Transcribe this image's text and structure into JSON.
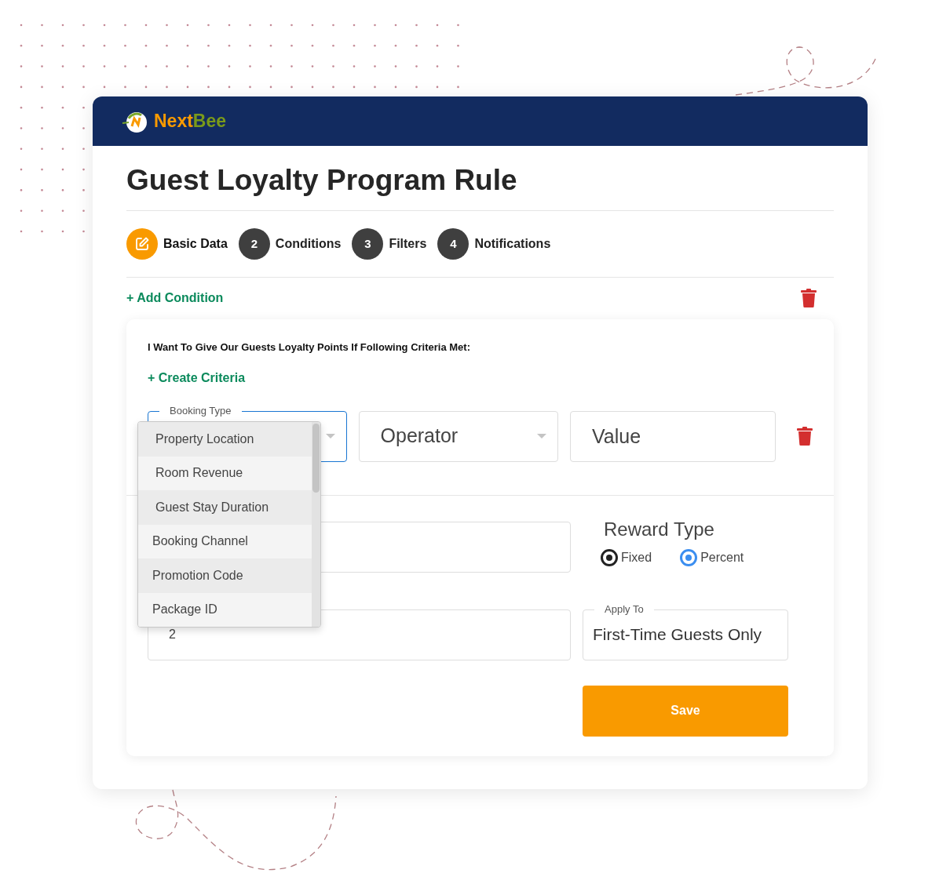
{
  "brand": {
    "part1": "Next",
    "part2": "Bee"
  },
  "title": "Guest Loyalty Program Rule",
  "steps": [
    {
      "label": "Basic Data",
      "kind": "icon",
      "selected": true
    },
    {
      "label": "Conditions",
      "kind": "number",
      "number": "2",
      "selected": false
    },
    {
      "label": "Filters",
      "kind": "number",
      "number": "3",
      "selected": false
    },
    {
      "label": "Notifications",
      "kind": "number",
      "number": "4",
      "selected": false
    }
  ],
  "add_condition": "+ Add Condition",
  "criteria_text": "I Want To Give Our Guests Loyalty Points If Following Criteria Met:",
  "create_criteria": "+ Create Criteria",
  "condition": {
    "field": {
      "label": "Booking Type",
      "expanded": true
    },
    "operator": {
      "placeholder": "Operator"
    },
    "value": {
      "placeholder": "Value"
    }
  },
  "dropdown_options": [
    {
      "label": "Property Location"
    },
    {
      "label": "Room Revenue"
    },
    {
      "label": "Guest Stay Duration"
    },
    {
      "label": "Booking Channel"
    },
    {
      "label": "Promotion Code"
    },
    {
      "label": "Package ID"
    }
  ],
  "amount_field": {
    "value": "2"
  },
  "reward_type": {
    "label": "Reward Type",
    "options": [
      {
        "label": "Fixed",
        "selected": true,
        "color": "#222222"
      },
      {
        "label": "Percent",
        "selected": true,
        "color": "#3b8ef0"
      }
    ]
  },
  "apply_to": {
    "label": "Apply To",
    "value": "First-Time Guests Only"
  },
  "save": "Save"
}
